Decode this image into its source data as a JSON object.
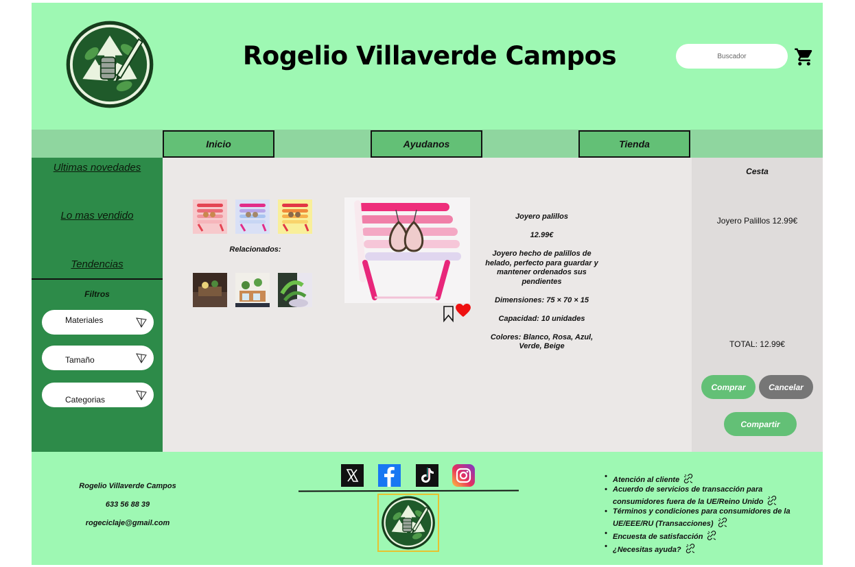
{
  "header": {
    "title": "Rogelio Villaverde Campos",
    "search_placeholder": "Buscador",
    "logo_icon": "recycle-logo-icon",
    "cart_icon": "shopping-cart-icon"
  },
  "nav": {
    "tabs": [
      {
        "label": "Inicio"
      },
      {
        "label": "Ayudanos"
      },
      {
        "label": "Tienda"
      }
    ]
  },
  "sidebar": {
    "links": [
      {
        "label": "Ultimas novedades"
      },
      {
        "label": "Lo mas vendido"
      },
      {
        "label": "Tendencias"
      }
    ],
    "filters_title": "Filtros",
    "filters": [
      {
        "label": "Materiales"
      },
      {
        "label": "Tamaño"
      },
      {
        "label": "Categorias"
      }
    ]
  },
  "product": {
    "related_label": "Relacionados:",
    "name": "Joyero palillos",
    "price": "12.99€",
    "description": "Joyero hecho de palillos de helado, perfecto para guardar y mantener ordenados sus pendientes",
    "dimensions": "Dimensiones: 75 × 70 × 15",
    "capacity": "Capacidad: 10 unidades",
    "colors": "Colores: Blanco, Rosa, Azul, Verde, Beige"
  },
  "basket": {
    "title": "Cesta",
    "item": "Joyero Palillos 12.99€",
    "total": "TOTAL: 12.99€",
    "buy_label": "Comprar",
    "cancel_label": "Cancelar",
    "share_label": "Compartir"
  },
  "footer": {
    "name": "Rogelio Villaverde Campos",
    "phone": "633 56 88 39",
    "email": "rogeciclaje@gmail.com",
    "social": [
      "x-icon",
      "facebook-icon",
      "tiktok-icon",
      "instagram-icon"
    ],
    "links": [
      {
        "label": "Atención al cliente"
      },
      {
        "label": "Acuerdo de servicios de transacción para consumidores fuera de la UE/Reino Unido"
      },
      {
        "label": "Términos y condiciones para consumidores de la UE/EEE/RU (Transacciones)"
      },
      {
        "label": "Encuesta de satisfacción"
      },
      {
        "label": "¿Necesitas ayuda?"
      }
    ]
  },
  "colors": {
    "header_bg": "#9ef8b3",
    "nav_bg": "#8fd69f",
    "tab_bg": "#63c076",
    "sidebar_bg": "#2d8b49",
    "main_bg": "#ebe8e7",
    "basket_bg": "#dfdcdb",
    "cancel_bg": "#767676"
  }
}
